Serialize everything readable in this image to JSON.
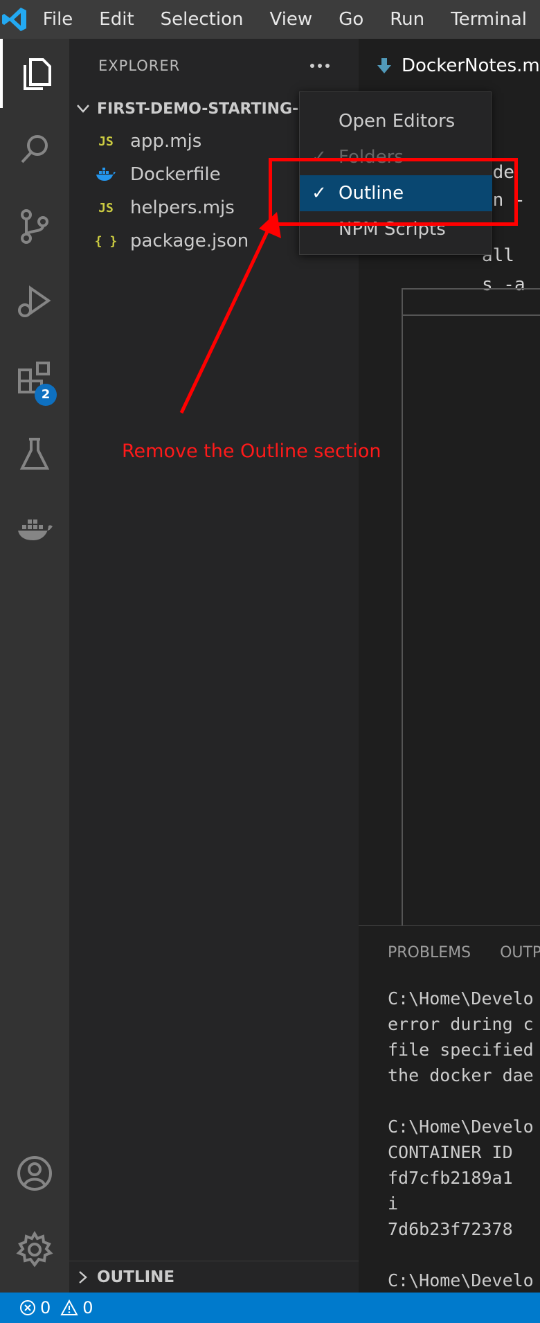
{
  "menu": {
    "items": [
      "File",
      "Edit",
      "Selection",
      "View",
      "Go",
      "Run",
      "Terminal"
    ]
  },
  "activity_bar": {
    "icons": [
      "explorer-icon",
      "search-icon",
      "source-control-icon",
      "run-debug-icon",
      "extensions-icon",
      "testing-icon",
      "docker-icon",
      "account-icon",
      "settings-gear-icon"
    ],
    "extensions_badge": "2"
  },
  "sidebar": {
    "title": "EXPLORER",
    "folder": "FIRST-DEMO-STARTING-S",
    "files": [
      {
        "name": "app.mjs",
        "icon": "JS"
      },
      {
        "name": "Dockerfile",
        "icon": "docker-file-icon"
      },
      {
        "name": "helpers.mjs",
        "icon": "JS"
      },
      {
        "name": "package.json",
        "icon": "{ }"
      }
    ],
    "outline_label": "OUTLINE"
  },
  "editor": {
    "tab_label": "DockerNotes.md",
    "code_fragments": [
      "ode",
      "un -",
      "all ",
      "s -a"
    ]
  },
  "context_menu": {
    "items": [
      {
        "label": "Open Editors",
        "checked": false
      },
      {
        "label": "Folders",
        "checked": true
      },
      {
        "label": "Outline",
        "checked": true
      },
      {
        "label": "NPM Scripts",
        "checked": false
      }
    ]
  },
  "panel": {
    "tabs": [
      "PROBLEMS",
      "OUTPU"
    ],
    "terminal_lines": [
      "C:\\Home\\Develo",
      "error during c",
      "file specified",
      "the docker dae",
      "",
      "C:\\Home\\Develo",
      "CONTAINER ID",
      "fd7cfb2189a1",
      "i",
      "7d6b23f72378",
      "",
      "C:\\Home\\Develo"
    ]
  },
  "status_bar": {
    "errors": "0",
    "warnings": "0"
  },
  "annotation": {
    "text": "Remove the Outline section",
    "color": "#ff0000"
  },
  "colors": {
    "accent": "#007acc",
    "menu_selection": "#094771"
  }
}
